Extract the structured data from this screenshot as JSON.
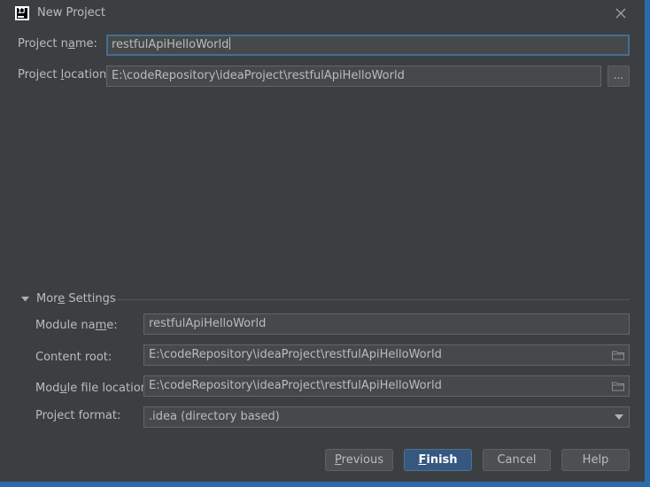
{
  "window": {
    "title": "New Project",
    "logo_text": "IJ"
  },
  "project": {
    "name_label_pre": "Project n",
    "name_label_ul": "a",
    "name_label_post": "me:",
    "name_value": "restfulApiHelloWorld",
    "location_label_pre": "Project ",
    "location_label_ul": "l",
    "location_label_post": "ocation:",
    "location_value": "E:\\codeRepository\\ideaProject\\restfulApiHelloWorld",
    "browse_label": "..."
  },
  "more_settings": {
    "label_pre": "Mor",
    "label_ul": "e",
    "label_post": " Settings",
    "module_name_label_pre": "Module na",
    "module_name_label_ul": "m",
    "module_name_label_post": "e:",
    "module_name_value": "restfulApiHelloWorld",
    "content_root_label": "Content root:",
    "content_root_value": "E:\\codeRepository\\ideaProject\\restfulApiHelloWorld",
    "module_file_label_pre": "Mod",
    "module_file_label_ul": "u",
    "module_file_label_post": "le file location:",
    "module_file_value": "E:\\codeRepository\\ideaProject\\restfulApiHelloWorld",
    "project_format_label": "Project format:",
    "project_format_value": ".idea (directory based)"
  },
  "buttons": {
    "previous_ul": "P",
    "previous_rest": "revious",
    "finish_ul": "F",
    "finish_rest": "inish",
    "cancel": "Cancel",
    "help": "Help"
  },
  "colors": {
    "background": "#3c3f41",
    "border_accent": "#2b6bab",
    "primary_button": "#365880",
    "focus_border": "#466d94"
  }
}
